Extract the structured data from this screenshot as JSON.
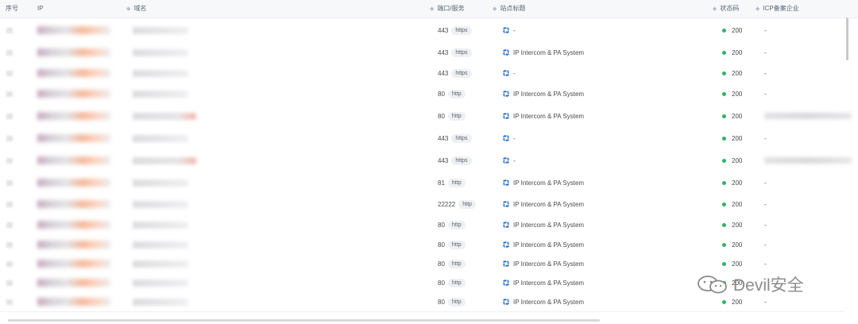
{
  "columns": {
    "index": "序号",
    "ip": "IP",
    "domain": "域名",
    "port_service": "端口/服务",
    "site_title": "站点标题",
    "status_code": "状态码",
    "icp": "ICP备案企业"
  },
  "rows": [
    {
      "port": "443",
      "service": "https",
      "title": "-",
      "status": "200",
      "icp": "-"
    },
    {
      "port": "443",
      "service": "https",
      "title": "IP Intercom & PA System",
      "status": "200",
      "icp": "-"
    },
    {
      "port": "443",
      "service": "https",
      "title": "-",
      "status": "200",
      "icp": "-"
    },
    {
      "port": "80",
      "service": "http",
      "title": "IP Intercom & PA System",
      "status": "200",
      "icp": "-"
    },
    {
      "port": "80",
      "service": "http",
      "title": "IP Intercom & PA System",
      "status": "200",
      "icp": ""
    },
    {
      "port": "443",
      "service": "https",
      "title": "-",
      "status": "200",
      "icp": "-"
    },
    {
      "port": "443",
      "service": "https",
      "title": "-",
      "status": "200",
      "icp": ""
    },
    {
      "port": "81",
      "service": "http",
      "title": "IP Intercom & PA System",
      "status": "200",
      "icp": "-"
    },
    {
      "port": "22222",
      "service": "http",
      "title": "IP Intercom & PA System",
      "status": "200",
      "icp": "-"
    },
    {
      "port": "80",
      "service": "http",
      "title": "IP Intercom & PA System",
      "status": "200",
      "icp": "-"
    },
    {
      "port": "80",
      "service": "http",
      "title": "IP Intercom & PA System",
      "status": "200",
      "icp": "-"
    },
    {
      "port": "80",
      "service": "http",
      "title": "IP Intercom & PA System",
      "status": "200",
      "icp": "-"
    },
    {
      "port": "80",
      "service": "http",
      "title": "IP Intercom & PA System",
      "status": "200",
      "icp": "-"
    },
    {
      "port": "80",
      "service": "http",
      "title": "IP Intercom & PA System",
      "status": "200",
      "icp": "-"
    }
  ],
  "watermark": {
    "text": "Devil安全",
    "icon": "wechat-icon"
  },
  "colors": {
    "status_ok": "#2fb26a",
    "title_icon": "#2d6fc1"
  }
}
